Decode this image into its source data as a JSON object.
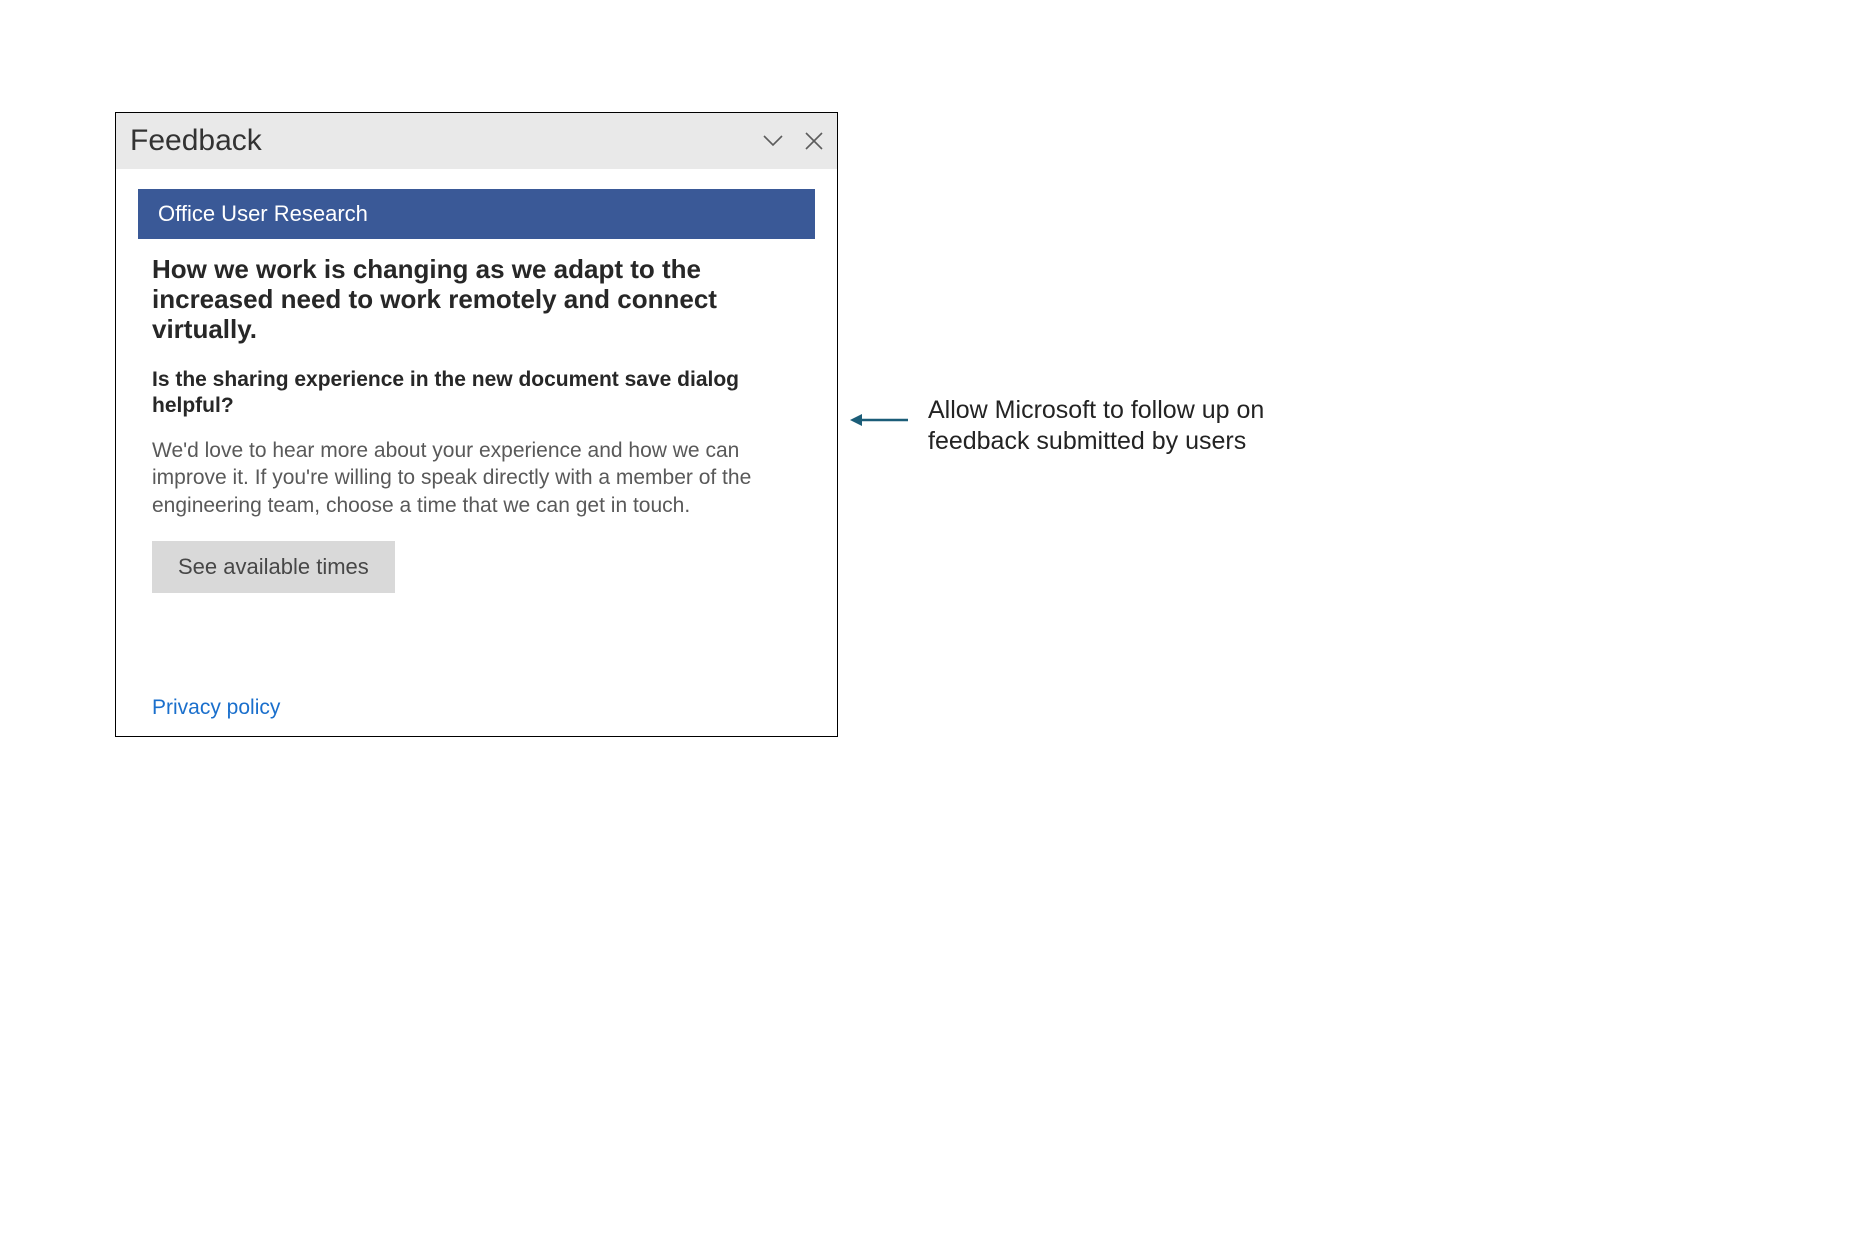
{
  "panel": {
    "title": "Feedback",
    "banner": "Office User Research",
    "heading": "How we work is changing as we adapt to the increased need to work remotely and connect virtually.",
    "subheading": "Is the sharing experience in the new document save dialog helpful?",
    "body": "We'd love to hear more about your experience and how we can improve it. If you're willing to speak directly with a member of the engineering team, choose a time that we can get in touch.",
    "cta_label": "See available times",
    "privacy_label": "Privacy policy"
  },
  "annotation": {
    "text": "Allow Microsoft to follow up on feedback submitted by users"
  },
  "colors": {
    "banner_bg": "#3a5997",
    "titlebar_bg": "#e9e9e9",
    "button_bg": "#d9d9d9",
    "link": "#1a6fcc",
    "arrow": "#1b5d78"
  }
}
